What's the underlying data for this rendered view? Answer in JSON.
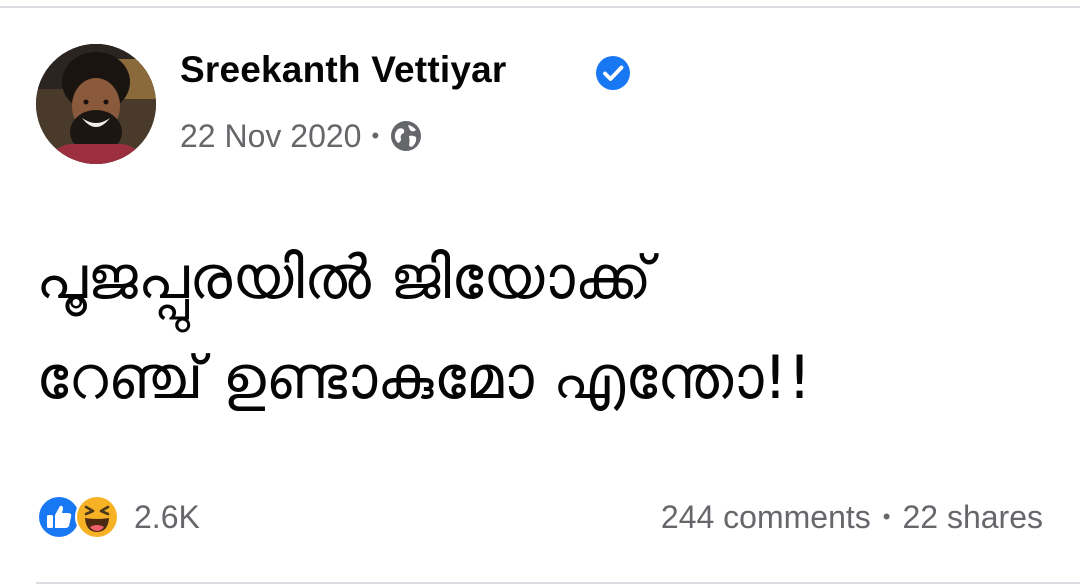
{
  "post": {
    "author_name": "Sreekanth Vettiyar",
    "verified": true,
    "date": "22 Nov 2020",
    "meta_separator": "•",
    "audience_icon": "globe-icon",
    "text_lines": [
      "പൂജപ്പുരയിൽ ജിയോക്ക്",
      "റേഞ്ച് ഉണ്ടാകുമോ എന്തോ!!"
    ]
  },
  "reactions": {
    "icons": [
      "like-icon",
      "haha-icon"
    ],
    "count": "2.6K"
  },
  "engagement": {
    "comments": "244 comments",
    "separator": "•",
    "shares": "22 shares"
  },
  "colors": {
    "facebook_blue": "#1877f2",
    "secondary_text": "#65676b",
    "divider": "#dadde1",
    "haha_yellow": "#f7b125"
  }
}
